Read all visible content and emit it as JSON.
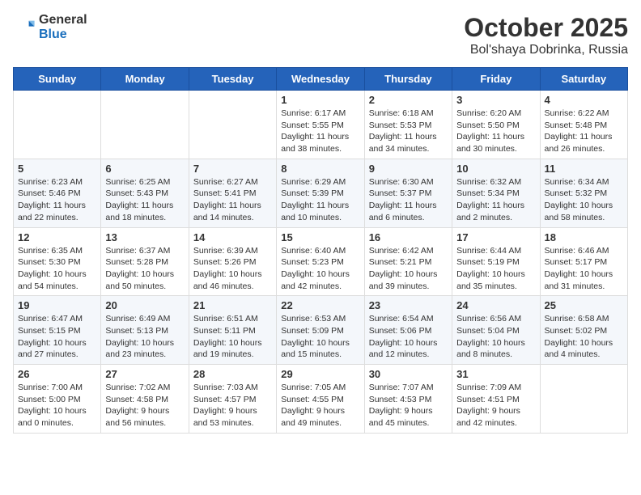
{
  "header": {
    "logo_general": "General",
    "logo_blue": "Blue",
    "main_title": "October 2025",
    "sub_title": "Bol'shaya Dobrinka, Russia"
  },
  "days_of_week": [
    "Sunday",
    "Monday",
    "Tuesday",
    "Wednesday",
    "Thursday",
    "Friday",
    "Saturday"
  ],
  "weeks": [
    [
      {
        "day": "",
        "info": ""
      },
      {
        "day": "",
        "info": ""
      },
      {
        "day": "",
        "info": ""
      },
      {
        "day": "1",
        "info": "Sunrise: 6:17 AM\nSunset: 5:55 PM\nDaylight: 11 hours\nand 38 minutes."
      },
      {
        "day": "2",
        "info": "Sunrise: 6:18 AM\nSunset: 5:53 PM\nDaylight: 11 hours\nand 34 minutes."
      },
      {
        "day": "3",
        "info": "Sunrise: 6:20 AM\nSunset: 5:50 PM\nDaylight: 11 hours\nand 30 minutes."
      },
      {
        "day": "4",
        "info": "Sunrise: 6:22 AM\nSunset: 5:48 PM\nDaylight: 11 hours\nand 26 minutes."
      }
    ],
    [
      {
        "day": "5",
        "info": "Sunrise: 6:23 AM\nSunset: 5:46 PM\nDaylight: 11 hours\nand 22 minutes."
      },
      {
        "day": "6",
        "info": "Sunrise: 6:25 AM\nSunset: 5:43 PM\nDaylight: 11 hours\nand 18 minutes."
      },
      {
        "day": "7",
        "info": "Sunrise: 6:27 AM\nSunset: 5:41 PM\nDaylight: 11 hours\nand 14 minutes."
      },
      {
        "day": "8",
        "info": "Sunrise: 6:29 AM\nSunset: 5:39 PM\nDaylight: 11 hours\nand 10 minutes."
      },
      {
        "day": "9",
        "info": "Sunrise: 6:30 AM\nSunset: 5:37 PM\nDaylight: 11 hours\nand 6 minutes."
      },
      {
        "day": "10",
        "info": "Sunrise: 6:32 AM\nSunset: 5:34 PM\nDaylight: 11 hours\nand 2 minutes."
      },
      {
        "day": "11",
        "info": "Sunrise: 6:34 AM\nSunset: 5:32 PM\nDaylight: 10 hours\nand 58 minutes."
      }
    ],
    [
      {
        "day": "12",
        "info": "Sunrise: 6:35 AM\nSunset: 5:30 PM\nDaylight: 10 hours\nand 54 minutes."
      },
      {
        "day": "13",
        "info": "Sunrise: 6:37 AM\nSunset: 5:28 PM\nDaylight: 10 hours\nand 50 minutes."
      },
      {
        "day": "14",
        "info": "Sunrise: 6:39 AM\nSunset: 5:26 PM\nDaylight: 10 hours\nand 46 minutes."
      },
      {
        "day": "15",
        "info": "Sunrise: 6:40 AM\nSunset: 5:23 PM\nDaylight: 10 hours\nand 42 minutes."
      },
      {
        "day": "16",
        "info": "Sunrise: 6:42 AM\nSunset: 5:21 PM\nDaylight: 10 hours\nand 39 minutes."
      },
      {
        "day": "17",
        "info": "Sunrise: 6:44 AM\nSunset: 5:19 PM\nDaylight: 10 hours\nand 35 minutes."
      },
      {
        "day": "18",
        "info": "Sunrise: 6:46 AM\nSunset: 5:17 PM\nDaylight: 10 hours\nand 31 minutes."
      }
    ],
    [
      {
        "day": "19",
        "info": "Sunrise: 6:47 AM\nSunset: 5:15 PM\nDaylight: 10 hours\nand 27 minutes."
      },
      {
        "day": "20",
        "info": "Sunrise: 6:49 AM\nSunset: 5:13 PM\nDaylight: 10 hours\nand 23 minutes."
      },
      {
        "day": "21",
        "info": "Sunrise: 6:51 AM\nSunset: 5:11 PM\nDaylight: 10 hours\nand 19 minutes."
      },
      {
        "day": "22",
        "info": "Sunrise: 6:53 AM\nSunset: 5:09 PM\nDaylight: 10 hours\nand 15 minutes."
      },
      {
        "day": "23",
        "info": "Sunrise: 6:54 AM\nSunset: 5:06 PM\nDaylight: 10 hours\nand 12 minutes."
      },
      {
        "day": "24",
        "info": "Sunrise: 6:56 AM\nSunset: 5:04 PM\nDaylight: 10 hours\nand 8 minutes."
      },
      {
        "day": "25",
        "info": "Sunrise: 6:58 AM\nSunset: 5:02 PM\nDaylight: 10 hours\nand 4 minutes."
      }
    ],
    [
      {
        "day": "26",
        "info": "Sunrise: 7:00 AM\nSunset: 5:00 PM\nDaylight: 10 hours\nand 0 minutes."
      },
      {
        "day": "27",
        "info": "Sunrise: 7:02 AM\nSunset: 4:58 PM\nDaylight: 9 hours\nand 56 minutes."
      },
      {
        "day": "28",
        "info": "Sunrise: 7:03 AM\nSunset: 4:57 PM\nDaylight: 9 hours\nand 53 minutes."
      },
      {
        "day": "29",
        "info": "Sunrise: 7:05 AM\nSunset: 4:55 PM\nDaylight: 9 hours\nand 49 minutes."
      },
      {
        "day": "30",
        "info": "Sunrise: 7:07 AM\nSunset: 4:53 PM\nDaylight: 9 hours\nand 45 minutes."
      },
      {
        "day": "31",
        "info": "Sunrise: 7:09 AM\nSunset: 4:51 PM\nDaylight: 9 hours\nand 42 minutes."
      },
      {
        "day": "",
        "info": ""
      }
    ]
  ]
}
